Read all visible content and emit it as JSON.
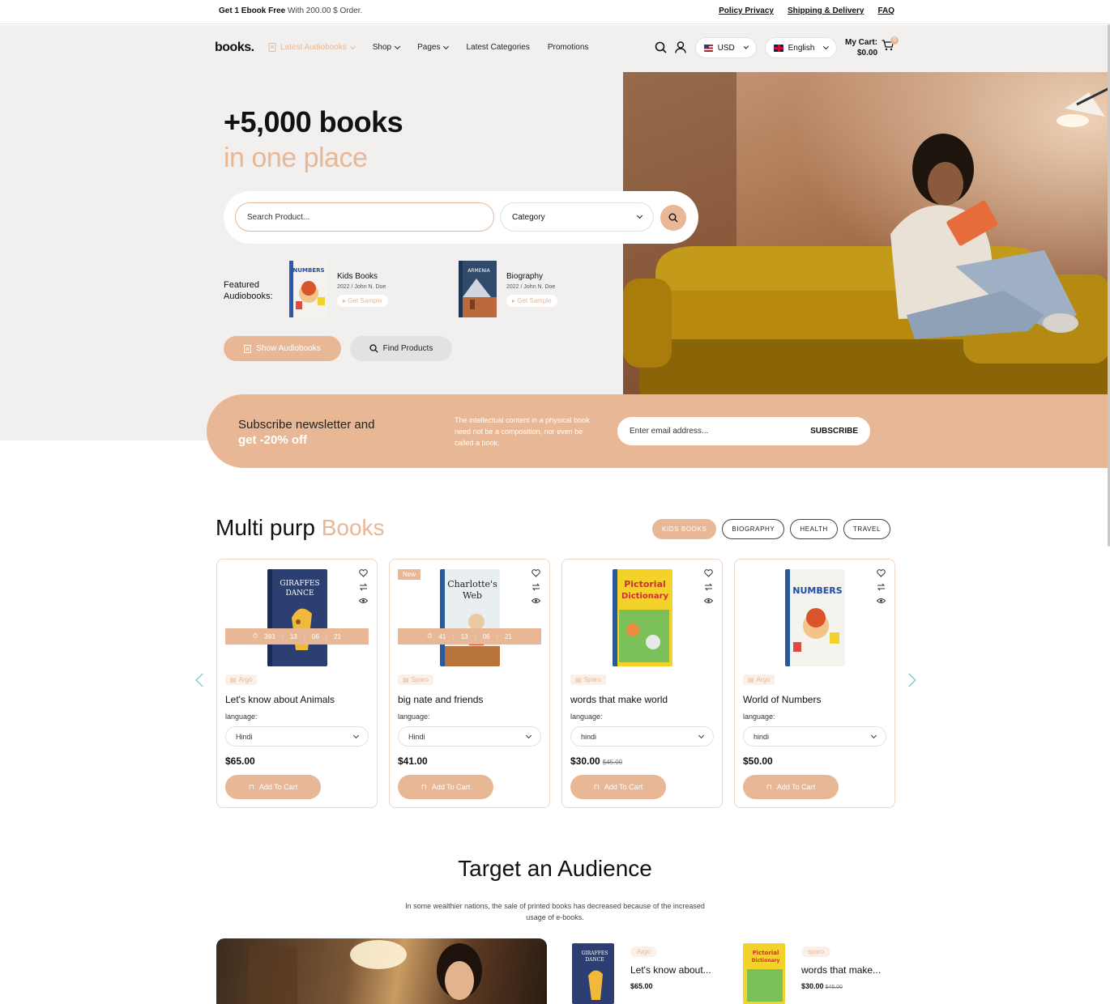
{
  "topbar": {
    "promo_bold": "Get 1 Ebook Free",
    "promo_rest": "With 200.00 $ Order.",
    "links": [
      "Policy Privacy",
      "Shipping & Delivery",
      "FAQ"
    ]
  },
  "header": {
    "logo": "books.",
    "nav": [
      "Latest Audiobooks",
      "Shop",
      "Pages",
      "Latest Categories",
      "Promotions"
    ],
    "currency": "USD",
    "language": "English",
    "cart_label": "My Cart:",
    "cart_total": "$0.00",
    "cart_count": "0"
  },
  "hero": {
    "title_line1": "+5,000 books",
    "title_line2": "in one place",
    "search_placeholder": "Search Product...",
    "category_label": "Category",
    "featured_label_1": "Featured",
    "featured_label_2": "Audiobooks:",
    "featured": [
      {
        "name": "Kids Books",
        "meta": "2022 / John N. Doe",
        "sample": "Get Sample"
      },
      {
        "name": "Biography",
        "meta": "2022 / John N. Doe",
        "sample": "Get Sample"
      }
    ],
    "btn_show": "Show Audiobooks",
    "btn_find": "Find Products"
  },
  "newsletter": {
    "title_line1": "Subscribe newsletter and",
    "title_line2": "get -20% off",
    "description": "The intellectual content in a physical book need not be a composition, nor even be called a book.",
    "email_placeholder": "Enter email address...",
    "subscribe": "SUBSCRIBE"
  },
  "products_section": {
    "title": "Multi purp",
    "title_accent": "Books",
    "filters": [
      "KIDS BOOKS",
      "BIOGRAPHY",
      "HEALTH",
      "TRAVEL"
    ],
    "language_label": "language:",
    "add_to_cart": "Add To Cart",
    "cards": [
      {
        "tag": "Argo",
        "title": "Let's know about Animals",
        "language": "Hindi",
        "price": "$65.00",
        "old_price": "",
        "badge": "",
        "timer": [
          "393",
          "13",
          "06",
          "21"
        ]
      },
      {
        "tag": "Sparo",
        "title": "big nate and friends",
        "language": "Hindi",
        "price": "$41.00",
        "old_price": "",
        "badge": "New",
        "timer": [
          "41",
          "13",
          "06",
          "21"
        ]
      },
      {
        "tag": "Sparo",
        "title": "words that make world",
        "language": "hindi",
        "price": "$30.00",
        "old_price": "$45.00",
        "badge": "",
        "timer": []
      },
      {
        "tag": "Argo",
        "title": "World of Numbers",
        "language": "hindi",
        "price": "$50.00",
        "old_price": "",
        "badge": "",
        "timer": []
      }
    ]
  },
  "audience": {
    "title": "Target an Audience",
    "description": "In some wealthier nations, the sale of printed books has decreased because of the increased usage of e-books.",
    "items": [
      {
        "tag": "Argo",
        "title": "Let's know about...",
        "price": "$65.00",
        "old_price": ""
      },
      {
        "tag": "sparo",
        "title": "words that make...",
        "price": "$30.00",
        "old_price": "$45.00"
      }
    ]
  },
  "colors": {
    "accent": "#e8b896",
    "background_panel": "#f1f0ef"
  }
}
